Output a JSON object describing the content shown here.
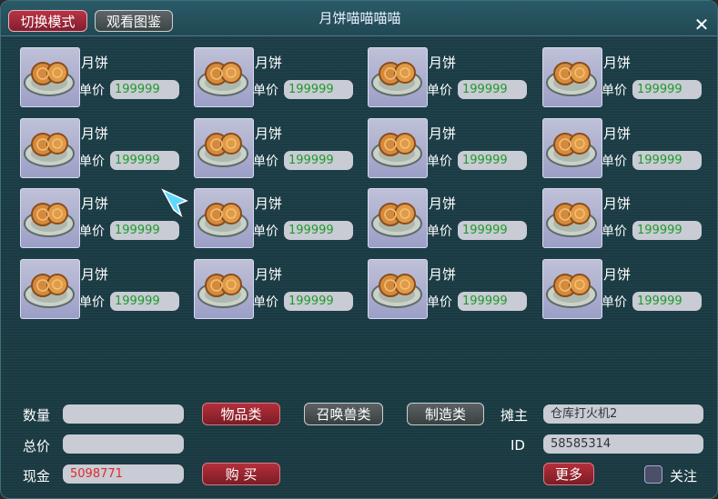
{
  "header": {
    "title": "月饼喵喵喵喵",
    "mode_button": "切换模式",
    "view_button": "观看图鉴",
    "close_glyph": "✕"
  },
  "items": [
    {
      "name": "月饼",
      "price_label": "单价",
      "price": "199999"
    },
    {
      "name": "月饼",
      "price_label": "单价",
      "price": "199999"
    },
    {
      "name": "月饼",
      "price_label": "单价",
      "price": "199999"
    },
    {
      "name": "月饼",
      "price_label": "单价",
      "price": "199999"
    },
    {
      "name": "月饼",
      "price_label": "单价",
      "price": "199999"
    },
    {
      "name": "月饼",
      "price_label": "单价",
      "price": "199999"
    },
    {
      "name": "月饼",
      "price_label": "单价",
      "price": "199999"
    },
    {
      "name": "月饼",
      "price_label": "单价",
      "price": "199999"
    },
    {
      "name": "月饼",
      "price_label": "单价",
      "price": "199999"
    },
    {
      "name": "月饼",
      "price_label": "单价",
      "price": "199999"
    },
    {
      "name": "月饼",
      "price_label": "单价",
      "price": "199999"
    },
    {
      "name": "月饼",
      "price_label": "单价",
      "price": "199999"
    },
    {
      "name": "月饼",
      "price_label": "单价",
      "price": "199999"
    },
    {
      "name": "月饼",
      "price_label": "单价",
      "price": "199999"
    },
    {
      "name": "月饼",
      "price_label": "单价",
      "price": "199999"
    },
    {
      "name": "月饼",
      "price_label": "单价",
      "price": "199999"
    }
  ],
  "bottom": {
    "quantity_label": "数量",
    "quantity_value": "",
    "total_label": "总价",
    "total_value": "",
    "cash_label": "现金",
    "cash_value": "5098771",
    "buy_button": "购 买",
    "category_items": "物品类",
    "category_pets": "召唤兽类",
    "category_crafts": "制造类",
    "owner_label": "摊主",
    "owner_value": "仓库打火机2",
    "id_label": "ID",
    "id_value": "58585314",
    "more_button": "更多",
    "follow_label": "关注"
  },
  "colors": {
    "price_text": "#1f9a2b",
    "cash_text": "#e02a2a",
    "accent_red": "#b42f3a"
  },
  "icons": {
    "item_icon": "mooncake-icon",
    "cursor_icon": "cursor-icon"
  }
}
